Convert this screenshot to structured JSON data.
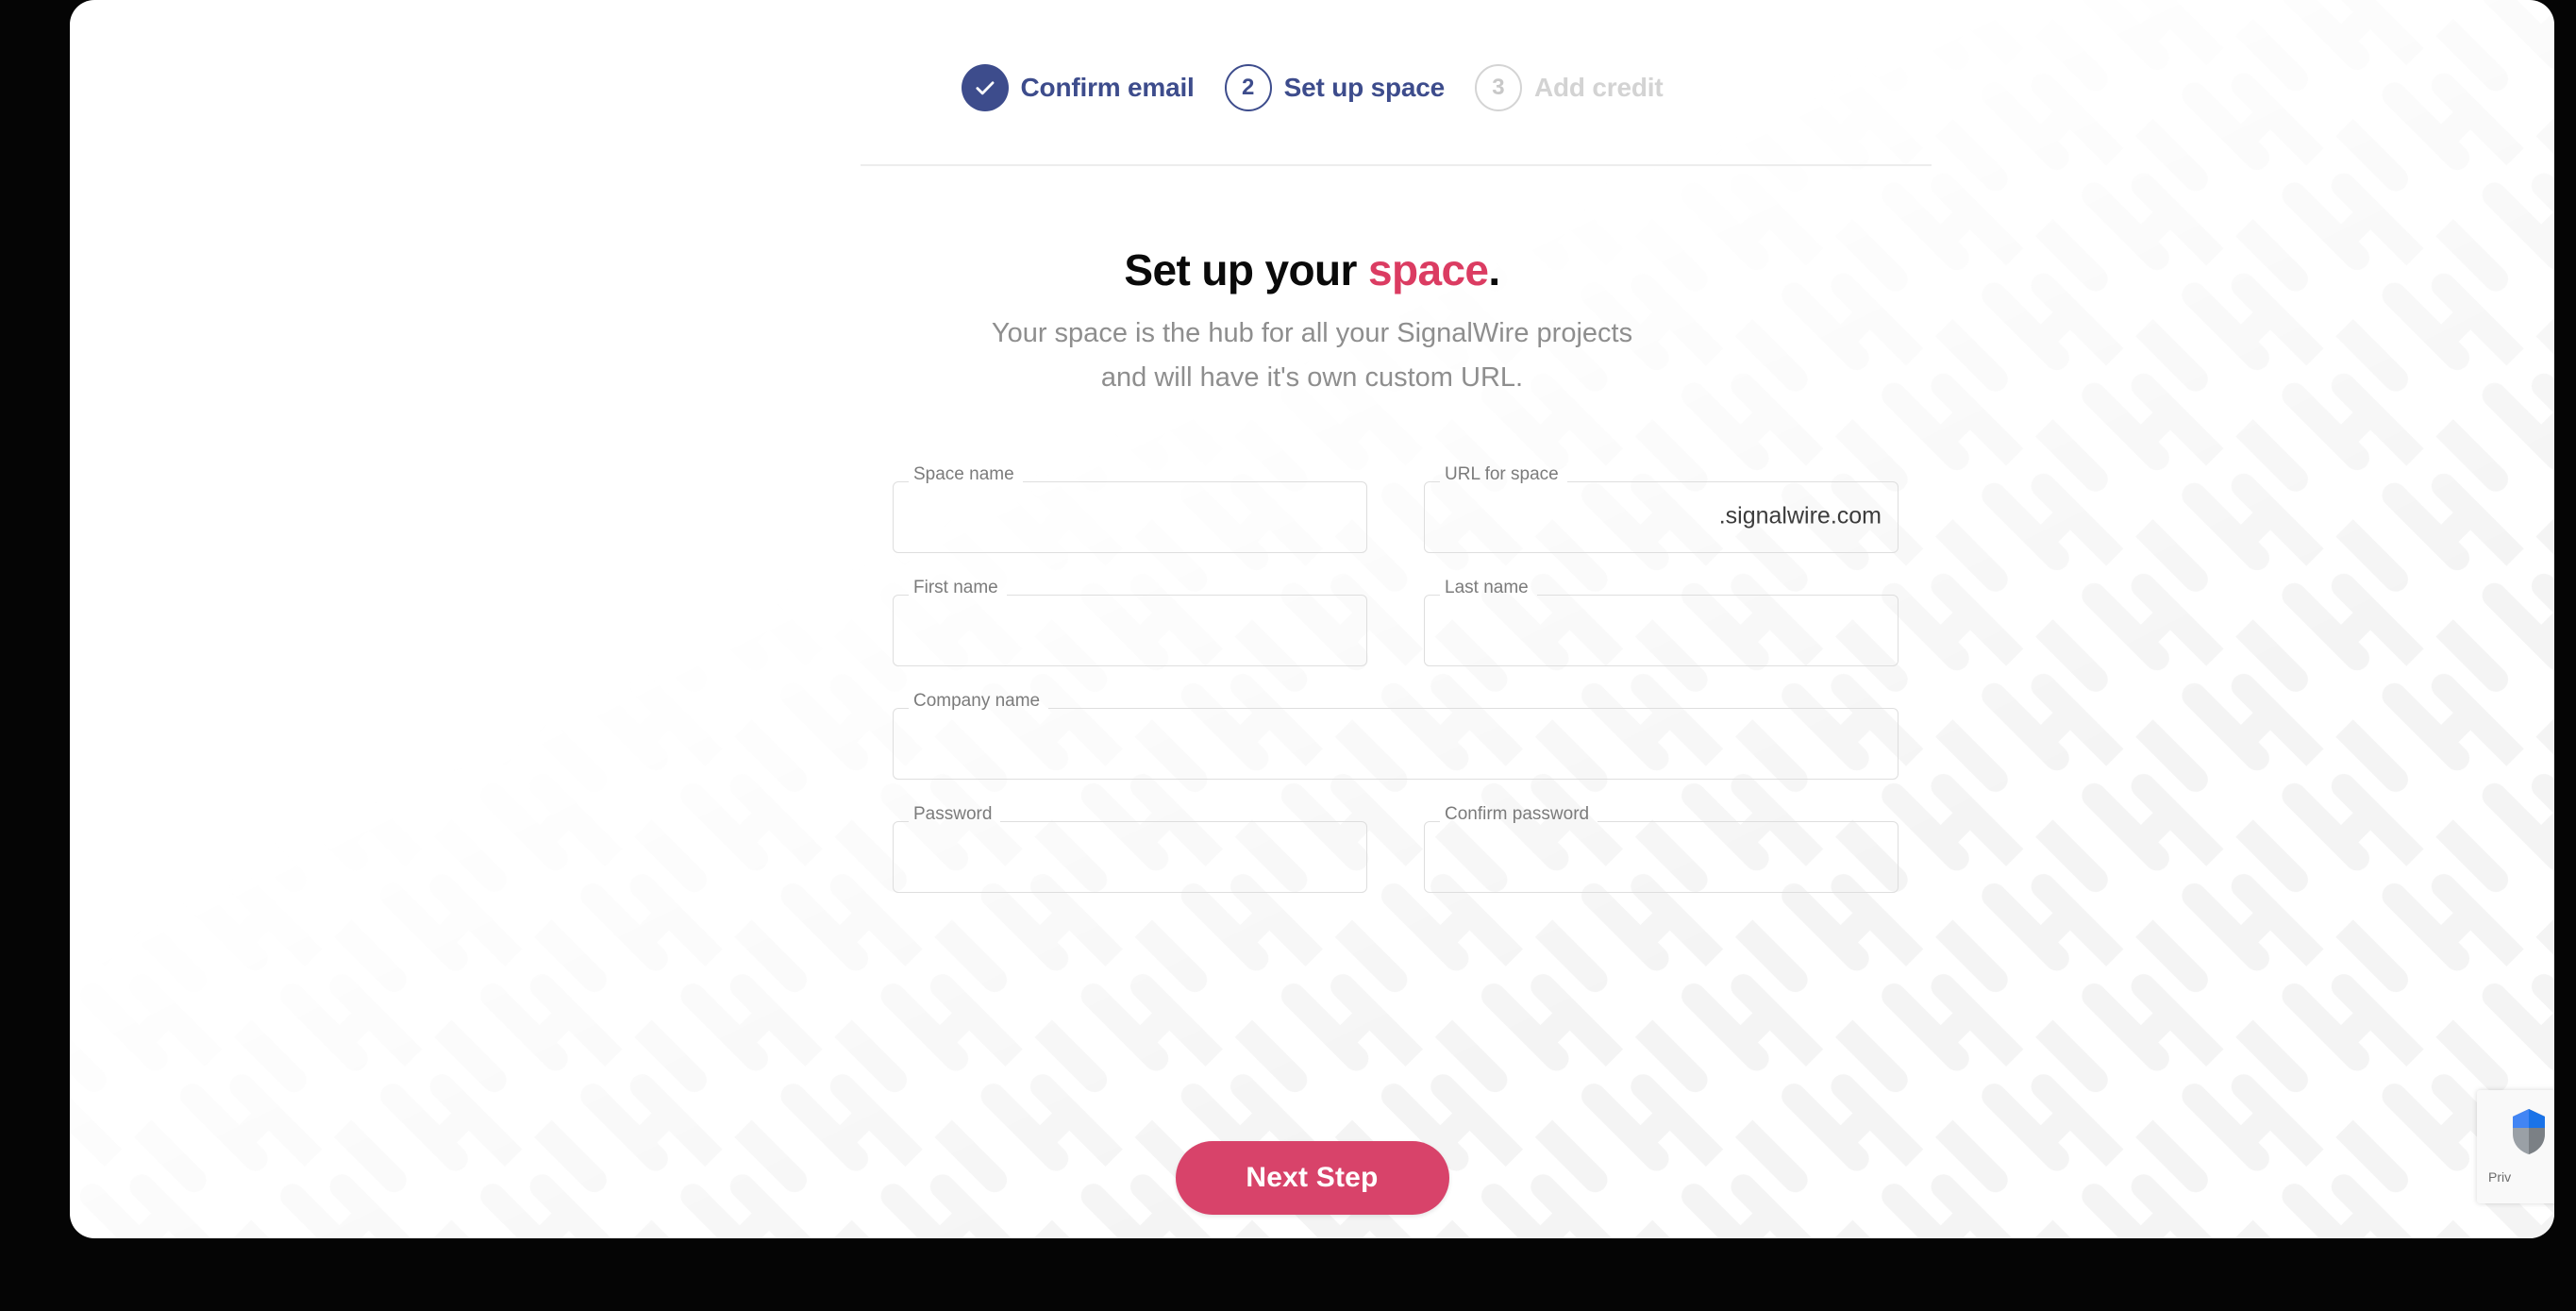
{
  "stepper": {
    "steps": [
      {
        "marker": "check-icon",
        "number": "",
        "label": "Confirm email",
        "state": "done"
      },
      {
        "marker": "2",
        "number": "2",
        "label": "Set up space",
        "state": "active"
      },
      {
        "marker": "3",
        "number": "3",
        "label": "Add credit",
        "state": "todo"
      }
    ]
  },
  "headline": {
    "prefix": "Set up your ",
    "accent": "space",
    "suffix": "."
  },
  "subhead": {
    "line1": "Your space is the hub for all your SignalWire projects",
    "line2": "and will have it's own custom URL."
  },
  "form": {
    "fields": [
      {
        "name": "space-name",
        "label": "Space name",
        "value": "",
        "placeholder": "",
        "suffix": ""
      },
      {
        "name": "url-for-space",
        "label": "URL for space",
        "value": "",
        "placeholder": "",
        "suffix": ".signalwire.com"
      },
      {
        "name": "first-name",
        "label": "First name",
        "value": "",
        "placeholder": "",
        "suffix": ""
      },
      {
        "name": "last-name",
        "label": "Last name",
        "value": "",
        "placeholder": "",
        "suffix": ""
      },
      {
        "name": "company-name",
        "label": "Company name",
        "value": "",
        "placeholder": "",
        "suffix": ""
      },
      {
        "name": "password",
        "label": "Password",
        "value": "",
        "placeholder": "",
        "suffix": ""
      },
      {
        "name": "confirm-password",
        "label": "Confirm password",
        "value": "",
        "placeholder": "",
        "suffix": ""
      }
    ]
  },
  "cta": {
    "next_label": "Next Step"
  },
  "recaptcha": {
    "text": "Priv"
  },
  "colors": {
    "accent_pink": "#db3c62",
    "button_pink": "#d8436a",
    "step_navy": "#3d4c8c",
    "muted_gray": "#8e8e8e",
    "disabled_gray": "#d3d3d3",
    "field_border": "#dedede"
  }
}
